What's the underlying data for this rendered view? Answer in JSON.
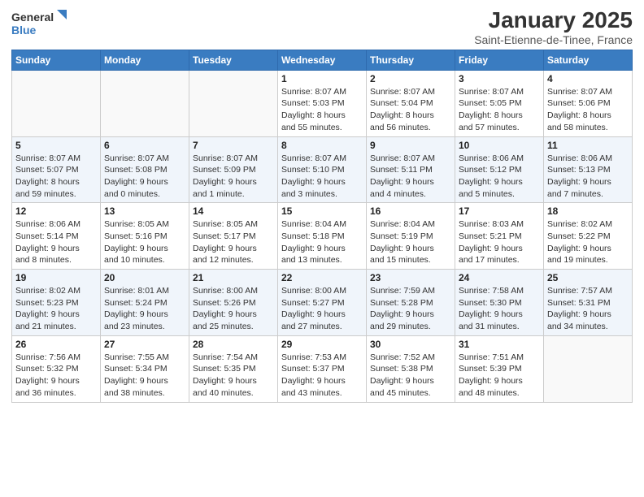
{
  "logo": {
    "line1": "General",
    "line2": "Blue"
  },
  "title": "January 2025",
  "subtitle": "Saint-Etienne-de-Tinee, France",
  "weekdays": [
    "Sunday",
    "Monday",
    "Tuesday",
    "Wednesday",
    "Thursday",
    "Friday",
    "Saturday"
  ],
  "weeks": [
    [
      {
        "day": "",
        "info": ""
      },
      {
        "day": "",
        "info": ""
      },
      {
        "day": "",
        "info": ""
      },
      {
        "day": "1",
        "info": "Sunrise: 8:07 AM\nSunset: 5:03 PM\nDaylight: 8 hours\nand 55 minutes."
      },
      {
        "day": "2",
        "info": "Sunrise: 8:07 AM\nSunset: 5:04 PM\nDaylight: 8 hours\nand 56 minutes."
      },
      {
        "day": "3",
        "info": "Sunrise: 8:07 AM\nSunset: 5:05 PM\nDaylight: 8 hours\nand 57 minutes."
      },
      {
        "day": "4",
        "info": "Sunrise: 8:07 AM\nSunset: 5:06 PM\nDaylight: 8 hours\nand 58 minutes."
      }
    ],
    [
      {
        "day": "5",
        "info": "Sunrise: 8:07 AM\nSunset: 5:07 PM\nDaylight: 8 hours\nand 59 minutes."
      },
      {
        "day": "6",
        "info": "Sunrise: 8:07 AM\nSunset: 5:08 PM\nDaylight: 9 hours\nand 0 minutes."
      },
      {
        "day": "7",
        "info": "Sunrise: 8:07 AM\nSunset: 5:09 PM\nDaylight: 9 hours\nand 1 minute."
      },
      {
        "day": "8",
        "info": "Sunrise: 8:07 AM\nSunset: 5:10 PM\nDaylight: 9 hours\nand 3 minutes."
      },
      {
        "day": "9",
        "info": "Sunrise: 8:07 AM\nSunset: 5:11 PM\nDaylight: 9 hours\nand 4 minutes."
      },
      {
        "day": "10",
        "info": "Sunrise: 8:06 AM\nSunset: 5:12 PM\nDaylight: 9 hours\nand 5 minutes."
      },
      {
        "day": "11",
        "info": "Sunrise: 8:06 AM\nSunset: 5:13 PM\nDaylight: 9 hours\nand 7 minutes."
      }
    ],
    [
      {
        "day": "12",
        "info": "Sunrise: 8:06 AM\nSunset: 5:14 PM\nDaylight: 9 hours\nand 8 minutes."
      },
      {
        "day": "13",
        "info": "Sunrise: 8:05 AM\nSunset: 5:16 PM\nDaylight: 9 hours\nand 10 minutes."
      },
      {
        "day": "14",
        "info": "Sunrise: 8:05 AM\nSunset: 5:17 PM\nDaylight: 9 hours\nand 12 minutes."
      },
      {
        "day": "15",
        "info": "Sunrise: 8:04 AM\nSunset: 5:18 PM\nDaylight: 9 hours\nand 13 minutes."
      },
      {
        "day": "16",
        "info": "Sunrise: 8:04 AM\nSunset: 5:19 PM\nDaylight: 9 hours\nand 15 minutes."
      },
      {
        "day": "17",
        "info": "Sunrise: 8:03 AM\nSunset: 5:21 PM\nDaylight: 9 hours\nand 17 minutes."
      },
      {
        "day": "18",
        "info": "Sunrise: 8:02 AM\nSunset: 5:22 PM\nDaylight: 9 hours\nand 19 minutes."
      }
    ],
    [
      {
        "day": "19",
        "info": "Sunrise: 8:02 AM\nSunset: 5:23 PM\nDaylight: 9 hours\nand 21 minutes."
      },
      {
        "day": "20",
        "info": "Sunrise: 8:01 AM\nSunset: 5:24 PM\nDaylight: 9 hours\nand 23 minutes."
      },
      {
        "day": "21",
        "info": "Sunrise: 8:00 AM\nSunset: 5:26 PM\nDaylight: 9 hours\nand 25 minutes."
      },
      {
        "day": "22",
        "info": "Sunrise: 8:00 AM\nSunset: 5:27 PM\nDaylight: 9 hours\nand 27 minutes."
      },
      {
        "day": "23",
        "info": "Sunrise: 7:59 AM\nSunset: 5:28 PM\nDaylight: 9 hours\nand 29 minutes."
      },
      {
        "day": "24",
        "info": "Sunrise: 7:58 AM\nSunset: 5:30 PM\nDaylight: 9 hours\nand 31 minutes."
      },
      {
        "day": "25",
        "info": "Sunrise: 7:57 AM\nSunset: 5:31 PM\nDaylight: 9 hours\nand 34 minutes."
      }
    ],
    [
      {
        "day": "26",
        "info": "Sunrise: 7:56 AM\nSunset: 5:32 PM\nDaylight: 9 hours\nand 36 minutes."
      },
      {
        "day": "27",
        "info": "Sunrise: 7:55 AM\nSunset: 5:34 PM\nDaylight: 9 hours\nand 38 minutes."
      },
      {
        "day": "28",
        "info": "Sunrise: 7:54 AM\nSunset: 5:35 PM\nDaylight: 9 hours\nand 40 minutes."
      },
      {
        "day": "29",
        "info": "Sunrise: 7:53 AM\nSunset: 5:37 PM\nDaylight: 9 hours\nand 43 minutes."
      },
      {
        "day": "30",
        "info": "Sunrise: 7:52 AM\nSunset: 5:38 PM\nDaylight: 9 hours\nand 45 minutes."
      },
      {
        "day": "31",
        "info": "Sunrise: 7:51 AM\nSunset: 5:39 PM\nDaylight: 9 hours\nand 48 minutes."
      },
      {
        "day": "",
        "info": ""
      }
    ]
  ]
}
